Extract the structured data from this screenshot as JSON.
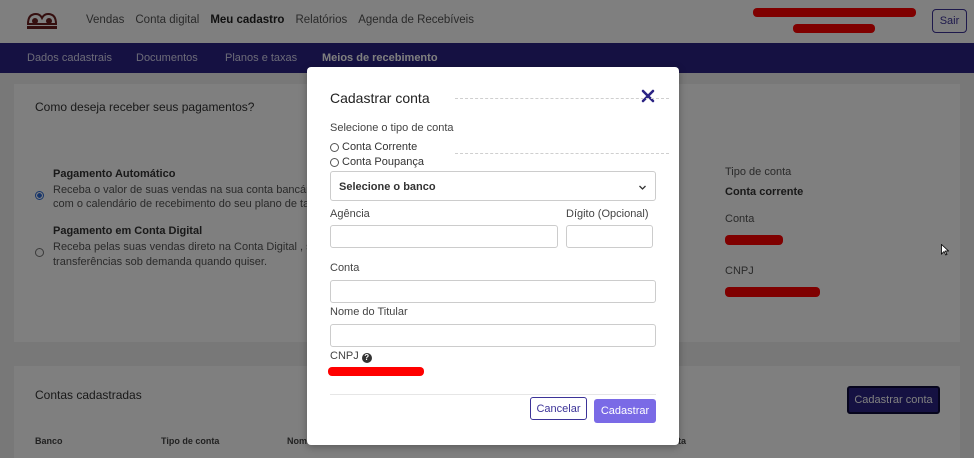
{
  "topnav": {
    "menu": [
      "Vendas",
      "Conta digital",
      "Meu cadastro",
      "Relatórios",
      "Agenda de Recebíveis"
    ],
    "active_index": 2,
    "logout_label": "Sair"
  },
  "subnav": {
    "tabs": [
      "Dados cadastrais",
      "Documentos",
      "Planos e taxas",
      "Meios de recebimento"
    ],
    "active_index": 3
  },
  "background": {
    "question": "Como deseja receber seus pagamentos?",
    "options": [
      {
        "title": "Pagamento Automático",
        "line1": "Receba o valor de suas vendas na sua conta bancária o",
        "line2": "com o calendário de recebimento do seu plano de taxas",
        "selected": true
      },
      {
        "title": "Pagamento em Conta Digital",
        "line1": "Receba pelas suas vendas direto na Conta Digital , sem",
        "line2": "transferências sob demanda quando quiser.",
        "selected": false
      }
    ],
    "account_info": {
      "type_label": "Tipo de conta",
      "type_value": "Conta corrente",
      "account_label": "Conta",
      "cnpj_label": "CNPJ"
    },
    "registered": {
      "title": "Contas cadastradas",
      "add_button": "Cadastrar conta",
      "columns": [
        "Banco",
        "Tipo de conta",
        "Nom",
        "ta"
      ]
    }
  },
  "modal": {
    "title": "Cadastrar conta",
    "account_type_label": "Selecione o tipo de conta",
    "account_types": [
      "Conta Corrente",
      "Conta Poupança"
    ],
    "bank_select": "Selecione o banco",
    "agency_label": "Agência",
    "digit_label": "Dígito (Opcional)",
    "account_label": "Conta",
    "holder_label": "Nome do Titular",
    "cnpj_label": "CNPJ",
    "cancel_label": "Cancelar",
    "submit_label": "Cadastrar"
  },
  "colors": {
    "brand": "#2b2384",
    "accent": "#7a6ae6",
    "redaction": "#ff0000"
  }
}
